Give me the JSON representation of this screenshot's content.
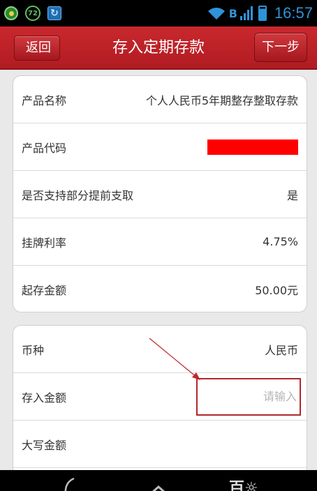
{
  "status_bar": {
    "badge_text": "72",
    "bluetooth_label": "B",
    "time": "16:57",
    "icons": [
      "notification-icon",
      "badge-icon",
      "update-icon",
      "wifi-icon",
      "signal-icon",
      "battery-icon"
    ]
  },
  "header": {
    "back_label": "返回",
    "title": "存入定期存款",
    "next_label": "下一步"
  },
  "product_info": {
    "rows": [
      {
        "label": "产品名称",
        "value": "个人人民币5年期整存整取存款"
      },
      {
        "label": "产品代码",
        "value": ""
      },
      {
        "label": "是否支持部分提前支取",
        "value": "是"
      },
      {
        "label": "挂牌利率",
        "value": "4.75%"
      },
      {
        "label": "起存金额",
        "value": "50.00元"
      }
    ]
  },
  "deposit_form": {
    "currency_label": "币种",
    "currency_value": "人民币",
    "amount_label": "存入金额",
    "amount_placeholder": "请输入",
    "amount_value": "",
    "uppercase_label": "大写金额",
    "uppercase_value": ""
  },
  "colors": {
    "header_red": "#b01c22",
    "redaction_red": "#ff0000",
    "highlight_border": "#b2272b",
    "arrow_red": "#c0282c",
    "status_blue": "#2f93d8"
  }
}
